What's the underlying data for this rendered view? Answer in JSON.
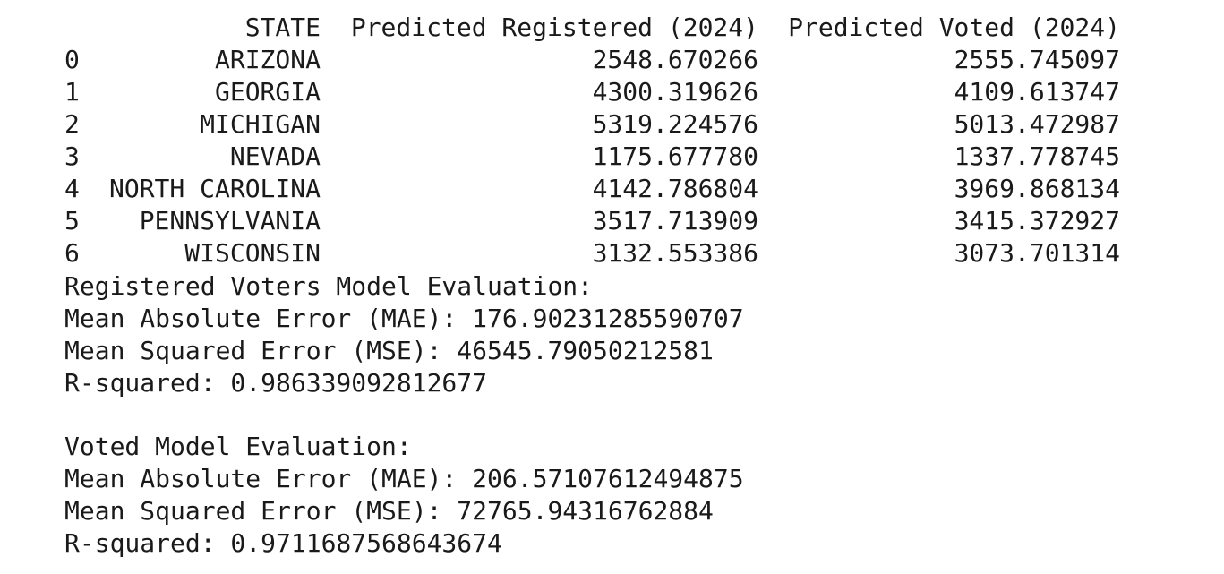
{
  "table": {
    "headers": {
      "state": "STATE",
      "registered": "Predicted Registered (2024)",
      "voted": "Predicted Voted (2024)"
    },
    "rows": [
      {
        "index": "0",
        "state": "ARIZONA",
        "registered": "2548.670266",
        "voted": "2555.745097"
      },
      {
        "index": "1",
        "state": "GEORGIA",
        "registered": "4300.319626",
        "voted": "4109.613747"
      },
      {
        "index": "2",
        "state": "MICHIGAN",
        "registered": "5319.224576",
        "voted": "5013.472987"
      },
      {
        "index": "3",
        "state": "NEVADA",
        "registered": "1175.677780",
        "voted": "1337.778745"
      },
      {
        "index": "4",
        "state": "NORTH CAROLINA",
        "registered": "4142.786804",
        "voted": "3969.868134"
      },
      {
        "index": "5",
        "state": "PENNSYLVANIA",
        "registered": "3517.713909",
        "voted": "3415.372927"
      },
      {
        "index": "6",
        "state": "WISCONSIN",
        "registered": "3132.553386",
        "voted": "3073.701314"
      }
    ]
  },
  "registered_eval": {
    "heading": "Registered Voters Model Evaluation:",
    "mae": "Mean Absolute Error (MAE): 176.90231285590707",
    "mse": "Mean Squared Error (MSE): 46545.79050212581",
    "r2": "R-squared: 0.986339092812677"
  },
  "voted_eval": {
    "heading": "Voted Model Evaluation:",
    "mae": "Mean Absolute Error (MAE): 206.57107612494875",
    "mse": "Mean Squared Error (MSE): 72765.94316762884",
    "r2": "R-squared: 0.9711687568643674"
  }
}
